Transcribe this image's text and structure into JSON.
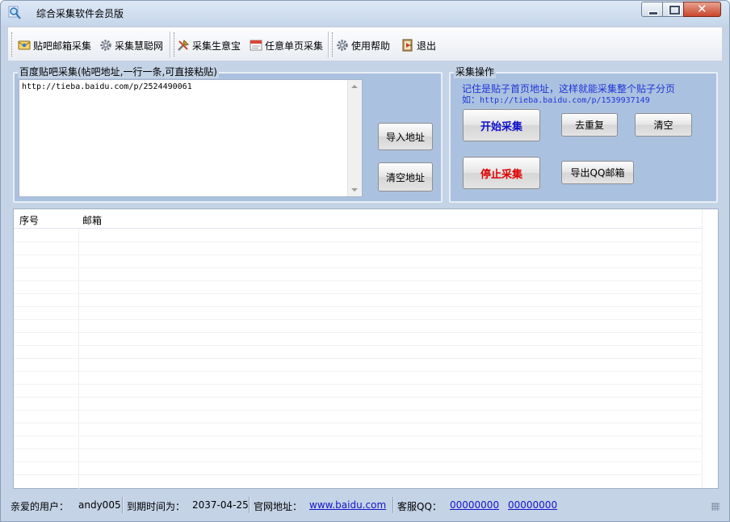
{
  "window": {
    "title": "综合采集软件会员版"
  },
  "toolbar": {
    "items": [
      {
        "label": "贴吧邮箱采集",
        "icon": "tieba-mail-icon"
      },
      {
        "label": "采集慧聪网",
        "icon": "gear-icon"
      },
      {
        "label": "采集生意宝",
        "icon": "tools-icon"
      },
      {
        "label": "任意单页采集",
        "icon": "page-icon"
      },
      {
        "label": "使用帮助",
        "icon": "gear-icon"
      },
      {
        "label": "退出",
        "icon": "exit-icon"
      }
    ]
  },
  "left_panel": {
    "legend": "百度贴吧采集(帖吧地址,一行一条,可直接粘贴)",
    "url_text": "http://tieba.baidu.com/p/2524490061",
    "import_button": "导入地址",
    "clear_button": "清空地址"
  },
  "right_panel": {
    "legend": "采集操作",
    "hint_line1": "记住是贴子首页地址，这样就能采集整个贴子分页",
    "hint_line2_prefix": "如：",
    "hint_line2_url": "http://tieba.baidu.com/p/1539937149",
    "start_button": "开始采集",
    "stop_button": "停止采集",
    "dedupe_button": "去重复",
    "clear_button": "清空",
    "export_button": "导出QQ邮箱"
  },
  "grid": {
    "columns": [
      "序号",
      "邮箱"
    ],
    "rows": []
  },
  "statusbar": {
    "user_label": "亲爱的用户：",
    "user_value": "andy005",
    "expire_label": "到期时间为：",
    "expire_value": "2037-04-25",
    "site_label": "官网地址：",
    "site_value": "www.baidu.com",
    "qq_label": "客服QQ：",
    "qq1": "00000000",
    "qq2": "00000000"
  },
  "colors": {
    "window_bg": "#c4d3e6",
    "panel_bg": "#abc1e0",
    "hint_text": "#1e36d6",
    "start_text": "#1212cc",
    "stop_text": "#e00000",
    "link": "#1414c8"
  }
}
